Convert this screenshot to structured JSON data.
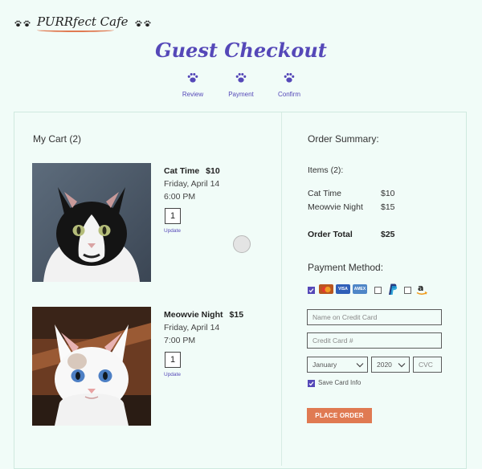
{
  "header": {
    "brand_name": "PURRfect Cafe",
    "title": "Guest Checkout",
    "steps": [
      {
        "label": "Review",
        "icon": "paw-icon"
      },
      {
        "label": "Payment",
        "icon": "paw-icon"
      },
      {
        "label": "Confirm",
        "icon": "paw-icon"
      }
    ]
  },
  "cart": {
    "heading": "My Cart (2)",
    "items": [
      {
        "name": "Cat Time",
        "price": "$10",
        "date": "Friday, April 14",
        "time": "6:00 PM",
        "quantity": "1",
        "update_label": "Update",
        "image": "black-white-kitten-photo"
      },
      {
        "name": "Meowvie Night",
        "price": "$15",
        "date": "Friday, April 14",
        "time": "7:00 PM",
        "quantity": "1",
        "update_label": "Update",
        "image": "blue-eyed-kitten-photo"
      }
    ]
  },
  "summary": {
    "heading": "Order Summary:",
    "items_label": "Items (2):",
    "lines": [
      {
        "name": "Cat Time",
        "price": "$10"
      },
      {
        "name": "Meowvie Night",
        "price": "$15"
      }
    ],
    "total_label": "Order Total",
    "total_value": "$25"
  },
  "payment": {
    "heading": "Payment Method:",
    "options": [
      {
        "name": "credit-cards",
        "checked": true
      },
      {
        "name": "paypal",
        "checked": false
      },
      {
        "name": "amazon",
        "checked": false
      }
    ],
    "card_logos": [
      "mastercard-icon",
      "visa-icon",
      "amex-icon"
    ],
    "name_placeholder": "Name on Credit Card",
    "card_placeholder": "Credit Card #",
    "month_value": "January",
    "year_value": "2020",
    "cvc_placeholder": "CVC",
    "save_label": "Save Card Info",
    "save_checked": true,
    "place_order_label": "PLACE ORDER"
  },
  "colors": {
    "accent": "#5548b8",
    "button": "#e07a52",
    "background": "#f1fcf8"
  }
}
